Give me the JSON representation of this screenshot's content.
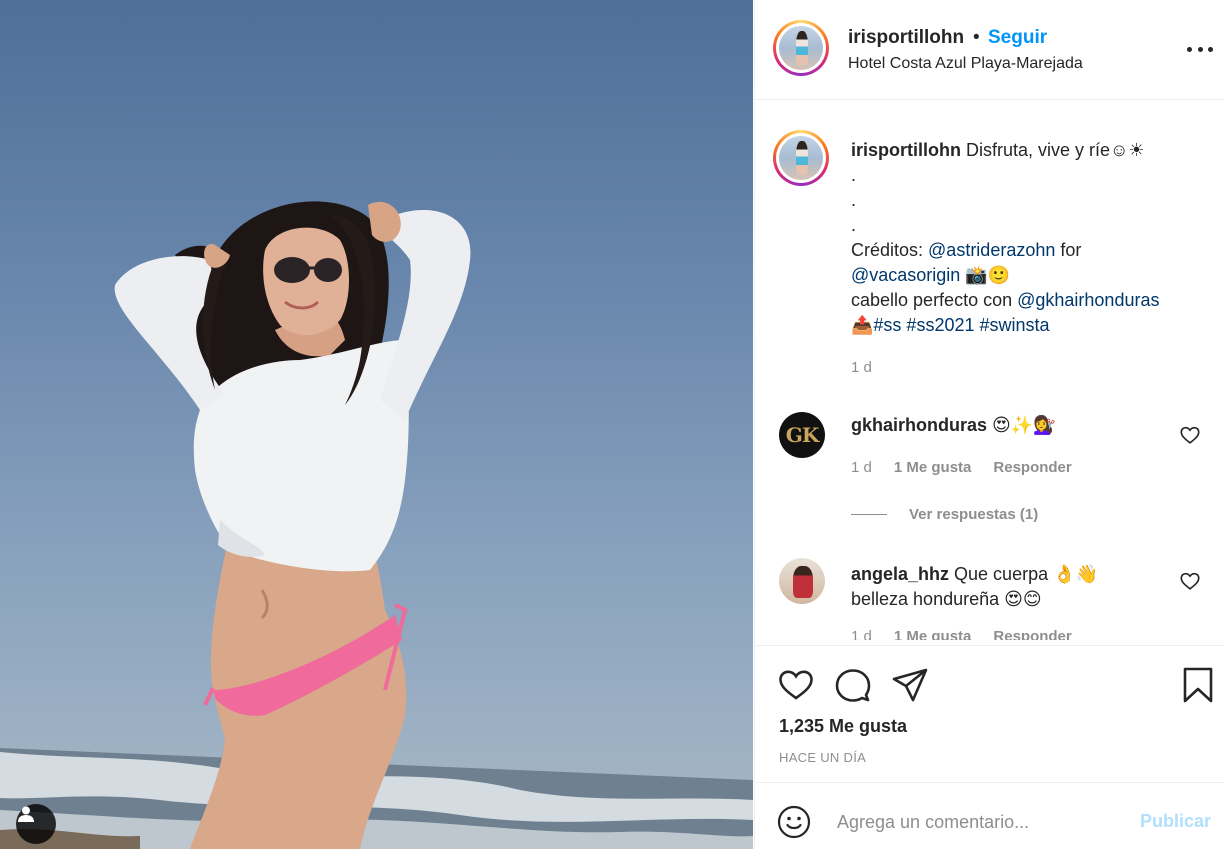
{
  "post": {
    "username": "irisportillohn",
    "separator": "•",
    "follow_label": "Seguir",
    "location": "Hotel Costa Azul Playa-Marejada"
  },
  "caption": {
    "username": "irisportillohn",
    "line1_text": "Disfruta, vive y ríe☺☀",
    "dot1": ".",
    "dot2": ".",
    "dot3": ".",
    "credits_prefix": "Créditos: ",
    "credits_mention": "@astriderazohn",
    "credits_suffix": " for",
    "mention2": "@vacasorigin",
    "mention2_suffix": " 📸🙂",
    "hair_prefix": "cabello perfecto con ",
    "hair_mention": "@gkhairhonduras",
    "hashtag_prefix": "📤",
    "hashtags": "#ss #ss2021 #swinsta",
    "time": "1 d"
  },
  "comments": [
    {
      "avatar_text": "GK",
      "username": "gkhairhonduras",
      "text": " 😍✨💇‍♀️",
      "time": "1 d",
      "likes": "1 Me gusta",
      "reply": "Responder",
      "view_replies": "Ver respuestas (1)"
    },
    {
      "username": "angela_hhz",
      "text": " Que cuerpa 👌👋",
      "text2": "belleza hondureña 😍😊",
      "time": "1 d",
      "likes": "1 Me gusta",
      "reply": "Responder"
    }
  ],
  "actions": {
    "likes": "1,235 Me gusta",
    "ago": "HACE UN DÍA"
  },
  "comment_box": {
    "placeholder": "Agrega un comentario...",
    "publish": "Publicar"
  },
  "colors": {
    "link_blue": "#0095f6",
    "mention_blue": "#00376b",
    "muted": "#8e8e8e",
    "publish_disabled": "#b2dffc"
  },
  "icons": {
    "more": "more-horizontal-icon",
    "heart": "heart-icon",
    "comment": "comment-icon",
    "share": "share-icon",
    "save": "bookmark-icon",
    "emoji": "emoji-icon",
    "user_tag": "user-tag-icon"
  }
}
